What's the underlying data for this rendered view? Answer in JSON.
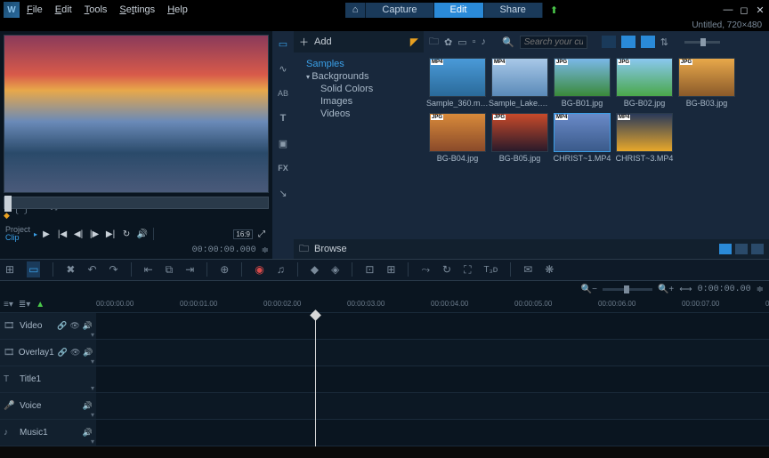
{
  "app": {
    "title": "Untitled, 720×480"
  },
  "menu": [
    "File",
    "Edit",
    "Tools",
    "Settings",
    "Help"
  ],
  "tabs": {
    "capture": "Capture",
    "edit": "Edit",
    "share": "Share"
  },
  "preview": {
    "project_label": "Project",
    "clip_label": "Clip",
    "timecode": "00:00:00.000",
    "aspect_badge": "16:9"
  },
  "library": {
    "add_label": "Add",
    "browse_label": "Browse",
    "search_placeholder": "Search your cu",
    "tree": {
      "samples": "Samples",
      "backgrounds": "Backgrounds",
      "solid_colors": "Solid Colors",
      "images": "Images",
      "videos": "Videos"
    },
    "thumbs": [
      {
        "name": "Sample_360.mp4",
        "badge": "MP4",
        "g": "linear-gradient(180deg,#4a9ad8,#2a6a9a)"
      },
      {
        "name": "Sample_Lake.m…",
        "badge": "MP4",
        "g": "linear-gradient(180deg,#a8c8e8,#5a8ab8)"
      },
      {
        "name": "BG-B01.jpg",
        "badge": "JPG",
        "g": "linear-gradient(180deg,#7ab8e8,#3a8a3a)"
      },
      {
        "name": "BG-B02.jpg",
        "badge": "JPG",
        "g": "linear-gradient(180deg,#8ac8f0,#4aa84a)"
      },
      {
        "name": "BG-B03.jpg",
        "badge": "JPG",
        "g": "linear-gradient(180deg,#e8a84a,#8a5a2a)"
      },
      {
        "name": "BG-B04.jpg",
        "badge": "JPG",
        "g": "linear-gradient(180deg,#d88a3a,#8a4a2a)"
      },
      {
        "name": "BG-B05.jpg",
        "badge": "JPG",
        "g": "linear-gradient(180deg,#c84a2a,#2a1a2a)"
      },
      {
        "name": "CHRIST~1.MP4",
        "badge": "MP4",
        "g": "linear-gradient(180deg,#6a8ac8,#3a5a8a)",
        "selected": true
      },
      {
        "name": "CHRIST~3.MP4",
        "badge": "MP4",
        "g": "linear-gradient(180deg,#2a3a5a,#e8a82a)"
      }
    ]
  },
  "ruler": {
    "ticks": [
      "00:00:00.00",
      "00:00:01.00",
      "00:00:02.00",
      "00:00:03.00",
      "00:00:04.00",
      "00:00:05.00",
      "00:00:06.00",
      "00:00:07.00",
      "00:00:"
    ],
    "zoom_tc": "0:00:00.00"
  },
  "tracks": [
    {
      "icon": "🎞",
      "name": "Video",
      "toggles": [
        "🔗",
        "👁",
        "🔊"
      ]
    },
    {
      "icon": "🎞",
      "name": "Overlay1",
      "toggles": [
        "🔗",
        "👁",
        "🔊"
      ]
    },
    {
      "icon": "T",
      "name": "Title1",
      "toggles": []
    },
    {
      "icon": "🎤",
      "name": "Voice",
      "toggles": [
        "🔊"
      ]
    },
    {
      "icon": "♪",
      "name": "Music1",
      "toggles": [
        "🔊"
      ]
    }
  ]
}
